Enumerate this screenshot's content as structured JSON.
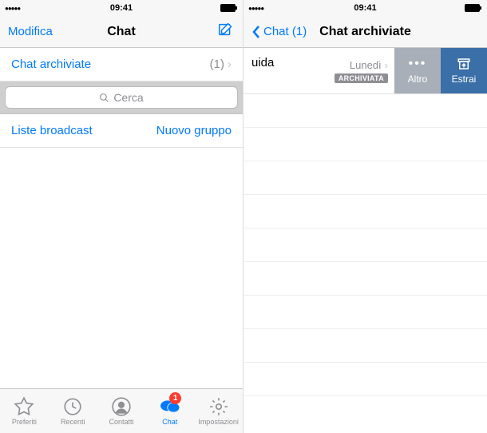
{
  "status": {
    "signal": "●●●●●",
    "time": "09:41"
  },
  "left": {
    "nav": {
      "edit": "Modifica",
      "title": "Chat"
    },
    "archived": {
      "label": "Chat archiviate",
      "count": "(1)"
    },
    "search": {
      "placeholder": "Cerca"
    },
    "lists": {
      "broadcast": "Liste broadcast",
      "newgroup": "Nuovo gruppo"
    },
    "tabs": {
      "favorites": "Preferiti",
      "recents": "Recenti",
      "contacts": "Contatti",
      "chat": "Chat",
      "settings": "Impostazioni",
      "badge": "1"
    }
  },
  "right": {
    "nav": {
      "back": "Chat (1)",
      "title": "Chat archiviate"
    },
    "item": {
      "name": "uida",
      "day": "Lunedì",
      "tag": "ARCHIVIATA"
    },
    "actions": {
      "more": "Altro",
      "extract": "Estrai"
    }
  }
}
